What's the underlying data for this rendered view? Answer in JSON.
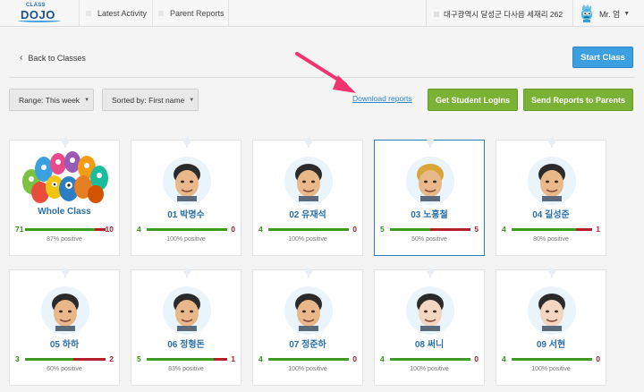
{
  "nav": {
    "logo_small": "CLASS",
    "logo_big": "DOJO",
    "latest_activity": "Latest Activity",
    "parent_reports": "Parent Reports",
    "school": "대구광역시 달성군 다사읍 세재리 262",
    "user": "Mr. 엄"
  },
  "toolbar": {
    "back": "Back to Classes",
    "start_class": "Start Class",
    "range_label": "Range:",
    "range_value": "This week",
    "sort_label": "Sorted by:",
    "sort_value": "First name",
    "download": "Download reports",
    "student_logins": "Get Student Logins",
    "send_reports": "Send Reports to Parents"
  },
  "colors": {
    "accent_blue": "#3b9fe0",
    "green_button": "#7bb235",
    "positive": "#3f9a21",
    "negative": "#b3202a",
    "annotation_arrow": "#f0346f"
  },
  "cards": [
    {
      "name": "Whole Class",
      "pos": "71",
      "neg": "10",
      "pct": "87% positive",
      "ratio": 0.87,
      "avatar": "monster-group-icon"
    },
    {
      "name": "01 박명수",
      "pos": "4",
      "neg": "0",
      "pct": "100% positive",
      "ratio": 1.0,
      "avatar": "student-avatar-icon"
    },
    {
      "name": "02 유재석",
      "pos": "4",
      "neg": "0",
      "pct": "100% positive",
      "ratio": 1.0,
      "avatar": "student-avatar-icon"
    },
    {
      "name": "03 노홍철",
      "pos": "5",
      "neg": "5",
      "pct": "50% positive",
      "ratio": 0.5,
      "avatar": "student-avatar-icon"
    },
    {
      "name": "04 길성준",
      "pos": "4",
      "neg": "1",
      "pct": "80% positive",
      "ratio": 0.8,
      "avatar": "student-avatar-icon"
    },
    {
      "name": "05 하하",
      "pos": "3",
      "neg": "2",
      "pct": "60% positive",
      "ratio": 0.6,
      "avatar": "student-avatar-icon"
    },
    {
      "name": "06 정형돈",
      "pos": "5",
      "neg": "1",
      "pct": "83% positive",
      "ratio": 0.83,
      "avatar": "student-avatar-icon"
    },
    {
      "name": "07 정준하",
      "pos": "4",
      "neg": "0",
      "pct": "100% positive",
      "ratio": 1.0,
      "avatar": "student-avatar-icon"
    },
    {
      "name": "08 써니",
      "pos": "4",
      "neg": "0",
      "pct": "100% positive",
      "ratio": 1.0,
      "avatar": "student-avatar-icon"
    },
    {
      "name": "09 서현",
      "pos": "4",
      "neg": "0",
      "pct": "100% positive",
      "ratio": 1.0,
      "avatar": "student-avatar-icon"
    }
  ]
}
